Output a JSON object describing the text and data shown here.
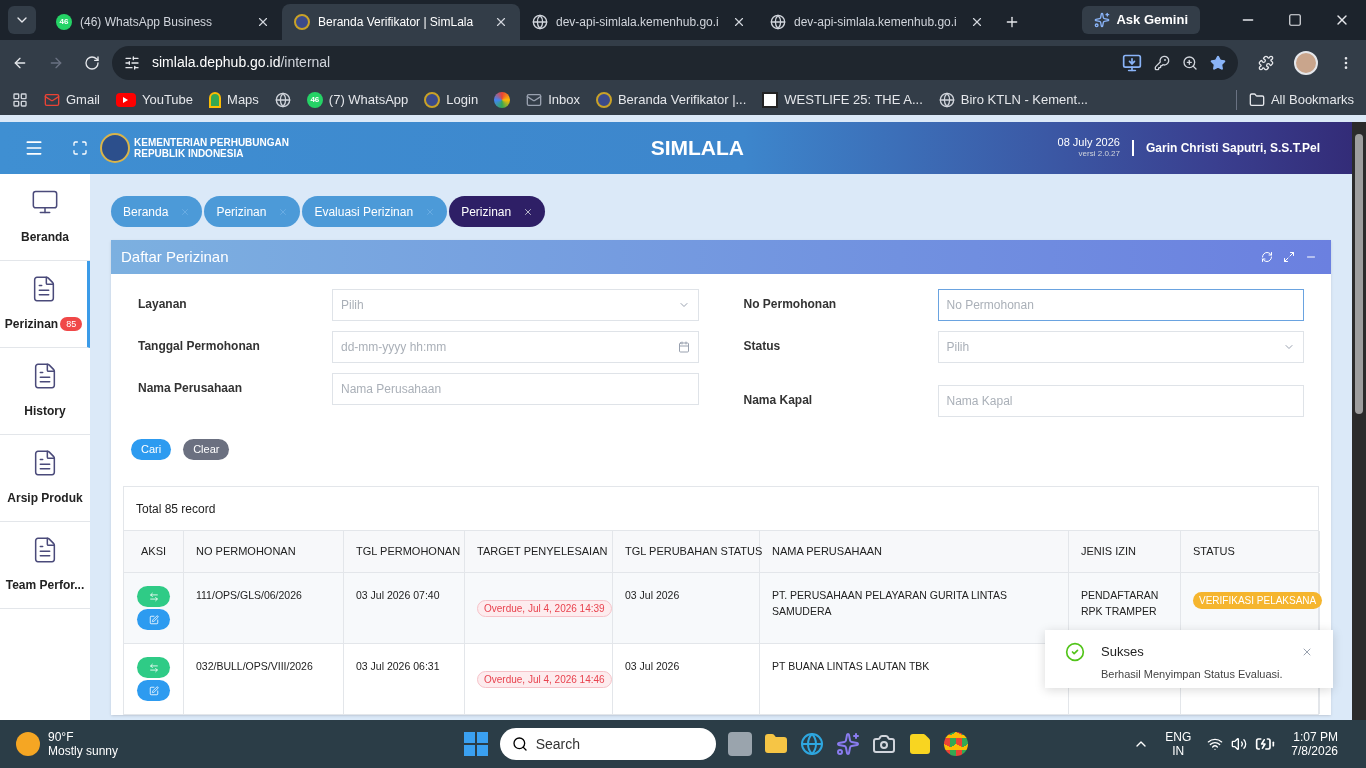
{
  "browser": {
    "tabs": [
      {
        "title": "(46) WhatsApp Business",
        "selected": false,
        "kind": "whatsapp",
        "count": "46"
      },
      {
        "title": "Beranda Verifikator | SimLala",
        "selected": true,
        "kind": "emblem"
      },
      {
        "title": "dev-api-simlala.kemenhub.go.i",
        "selected": false,
        "kind": "globe"
      },
      {
        "title": "dev-api-simlala.kemenhub.go.i",
        "selected": false,
        "kind": "globe"
      }
    ],
    "ask": "Ask Gemini",
    "address": "simlala.dephub.go.id",
    "address_path": "/internal",
    "bookmarks": [
      {
        "label": "Gmail",
        "kind": "gmail"
      },
      {
        "label": "YouTube",
        "kind": "youtube"
      },
      {
        "label": "Maps",
        "kind": "maps"
      },
      {
        "kind": "globe"
      },
      {
        "label": "(7) WhatsApp",
        "kind": "whatsapp",
        "count": "46"
      },
      {
        "label": "Login",
        "kind": "emblem"
      },
      {
        "kind": "photos"
      },
      {
        "label": "Inbox",
        "kind": "mail"
      },
      {
        "label": "Beranda Verifikator |...",
        "kind": "emblem"
      },
      {
        "label": "WESTLIFE 25: THE A...",
        "kind": "square"
      },
      {
        "label": "Biro KTLN - Kement...",
        "kind": "globe"
      }
    ],
    "all_bookmarks": "All Bookmarks"
  },
  "header": {
    "org_line1": "KEMENTERIAN PERHUBUNGAN",
    "org_line2": "REPUBLIK INDONESIA",
    "title": "SIMLALA",
    "date": "08 July 2026",
    "version": "versi 2.0.27",
    "user": "Garin Christi Saputri, S.S.T.Pel"
  },
  "sidebar": {
    "items": [
      {
        "label": "Beranda",
        "kind": "monitor",
        "selected": false
      },
      {
        "label": "Perizinan",
        "kind": "document",
        "selected": true,
        "badge": "85"
      },
      {
        "label": "History",
        "kind": "document",
        "selected": false
      },
      {
        "label": "Arsip Produk",
        "kind": "document",
        "selected": false
      },
      {
        "label": "Team Perfor...",
        "kind": "document",
        "selected": false
      }
    ]
  },
  "breadcrumbs": [
    {
      "label": "Beranda",
      "selected": false
    },
    {
      "label": "Perizinan",
      "selected": false
    },
    {
      "label": "Evaluasi Perizinan",
      "selected": false
    },
    {
      "label": "Perizinan",
      "selected": true
    }
  ],
  "panel": {
    "title": "Daftar Perizinan",
    "fields_left": [
      {
        "label": "Layanan",
        "kind": "select",
        "placeholder": "Pilih"
      },
      {
        "label": "Tanggal Permohonan",
        "kind": "date",
        "placeholder": "dd-mm-yyyy hh:mm"
      },
      {
        "label": "Nama Perusahaan",
        "kind": "text",
        "placeholder": "Nama Perusahaan"
      }
    ],
    "fields_right": [
      {
        "label": "No Permohonan",
        "kind": "text",
        "placeholder": "No Permohonan",
        "focused": true
      },
      {
        "label": "Status",
        "kind": "select",
        "placeholder": "Pilih",
        "focused": false
      },
      {
        "label": "Nama Kapal",
        "kind": "text",
        "placeholder": "Nama Kapal",
        "focused": false
      }
    ],
    "search_button": "Cari",
    "clear_button": "Clear",
    "table": {
      "total": "Total 85 record",
      "columns": [
        "AKSI",
        "NO PERMOHONAN",
        "TGL PERMOHONAN",
        "TARGET PENYELESAIAN",
        "TGL PERUBAHAN STATUS",
        "NAMA PERUSAHAAN",
        "JENIS IZIN",
        "STATUS"
      ],
      "rows": [
        {
          "no": "111/OPS/GLS/06/2026",
          "tgl": "03 Jul 2026 07:40",
          "target": "Overdue, Jul 4, 2026 14:39",
          "tgl_status": "03 Jul 2026",
          "perusahaan": "PT. PERUSAHAAN PELAYARAN GURITA LINTAS SAMUDERA",
          "jenis": "PENDAFTARAN RPK TRAMPER",
          "status": "VERIFIKASI PELAKSANA"
        },
        {
          "no": "032/BULL/OPS/VIII/2026",
          "tgl": "03 Jul 2026 06:31",
          "target": "Overdue, Jul 4, 2026 14:46",
          "tgl_status": "03 Jul 2026",
          "perusahaan": "PT BUANA LINTAS LAUTAN TBK"
        }
      ]
    }
  },
  "toast": {
    "title": "Sukses",
    "message": "Berhasil Menyimpan Status Evaluasi."
  },
  "taskbar": {
    "temperature": "90°F",
    "weather": "Mostly sunny",
    "search_placeholder": "Search",
    "lang1": "ENG",
    "lang2": "IN",
    "time": "1:07 PM",
    "date": "7/8/2026"
  }
}
